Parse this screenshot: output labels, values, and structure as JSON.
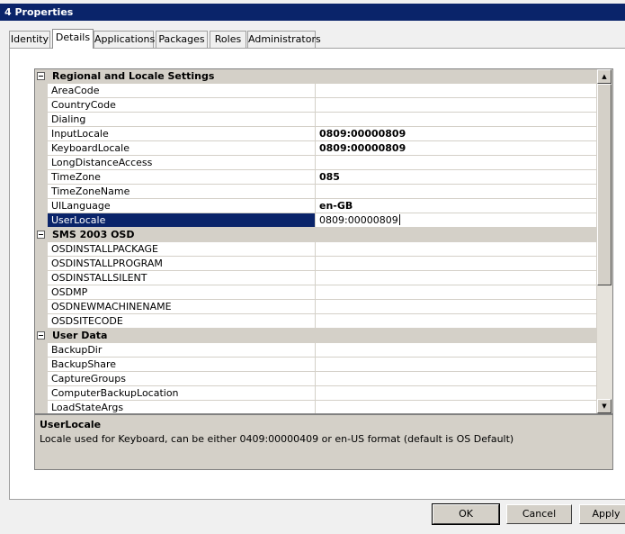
{
  "window": {
    "title": "4 Properties"
  },
  "tabs": [
    {
      "label": "Identity"
    },
    {
      "label": "Details"
    },
    {
      "label": "Applications"
    },
    {
      "label": "Packages"
    },
    {
      "label": "Roles"
    },
    {
      "label": "Administrators"
    }
  ],
  "active_tab": "Details",
  "categories": [
    {
      "label": "Regional and Locale Settings",
      "properties": [
        {
          "name": "AreaCode",
          "value": ""
        },
        {
          "name": "CountryCode",
          "value": ""
        },
        {
          "name": "Dialing",
          "value": ""
        },
        {
          "name": "InputLocale",
          "value": "0809:00000809"
        },
        {
          "name": "KeyboardLocale",
          "value": "0809:00000809"
        },
        {
          "name": "LongDistanceAccess",
          "value": ""
        },
        {
          "name": "TimeZone",
          "value": "085"
        },
        {
          "name": "TimeZoneName",
          "value": ""
        },
        {
          "name": "UILanguage",
          "value": "en-GB"
        },
        {
          "name": "UserLocale",
          "value": "0809:00000809",
          "selected": true
        }
      ]
    },
    {
      "label": "SMS 2003 OSD",
      "properties": [
        {
          "name": "OSDINSTALLPACKAGE",
          "value": ""
        },
        {
          "name": "OSDINSTALLPROGRAM",
          "value": ""
        },
        {
          "name": "OSDINSTALLSILENT",
          "value": ""
        },
        {
          "name": "OSDMP",
          "value": ""
        },
        {
          "name": "OSDNEWMACHINENAME",
          "value": ""
        },
        {
          "name": "OSDSITECODE",
          "value": ""
        }
      ]
    },
    {
      "label": "User Data",
      "properties": [
        {
          "name": "BackupDir",
          "value": ""
        },
        {
          "name": "BackupShare",
          "value": ""
        },
        {
          "name": "CaptureGroups",
          "value": ""
        },
        {
          "name": "ComputerBackupLocation",
          "value": ""
        },
        {
          "name": "LoadStateArgs",
          "value": ""
        }
      ]
    }
  ],
  "description": {
    "title": "UserLocale",
    "text": "Locale used for Keyboard, can be either 0409:00000409 or en-US format (default is OS Default)"
  },
  "buttons": {
    "ok": "OK",
    "cancel": "Cancel",
    "apply": "Apply"
  },
  "icons": {
    "collapse": "collapse-minus-icon",
    "scroll_up": "arrow-up-icon",
    "scroll_down": "arrow-down-icon"
  }
}
